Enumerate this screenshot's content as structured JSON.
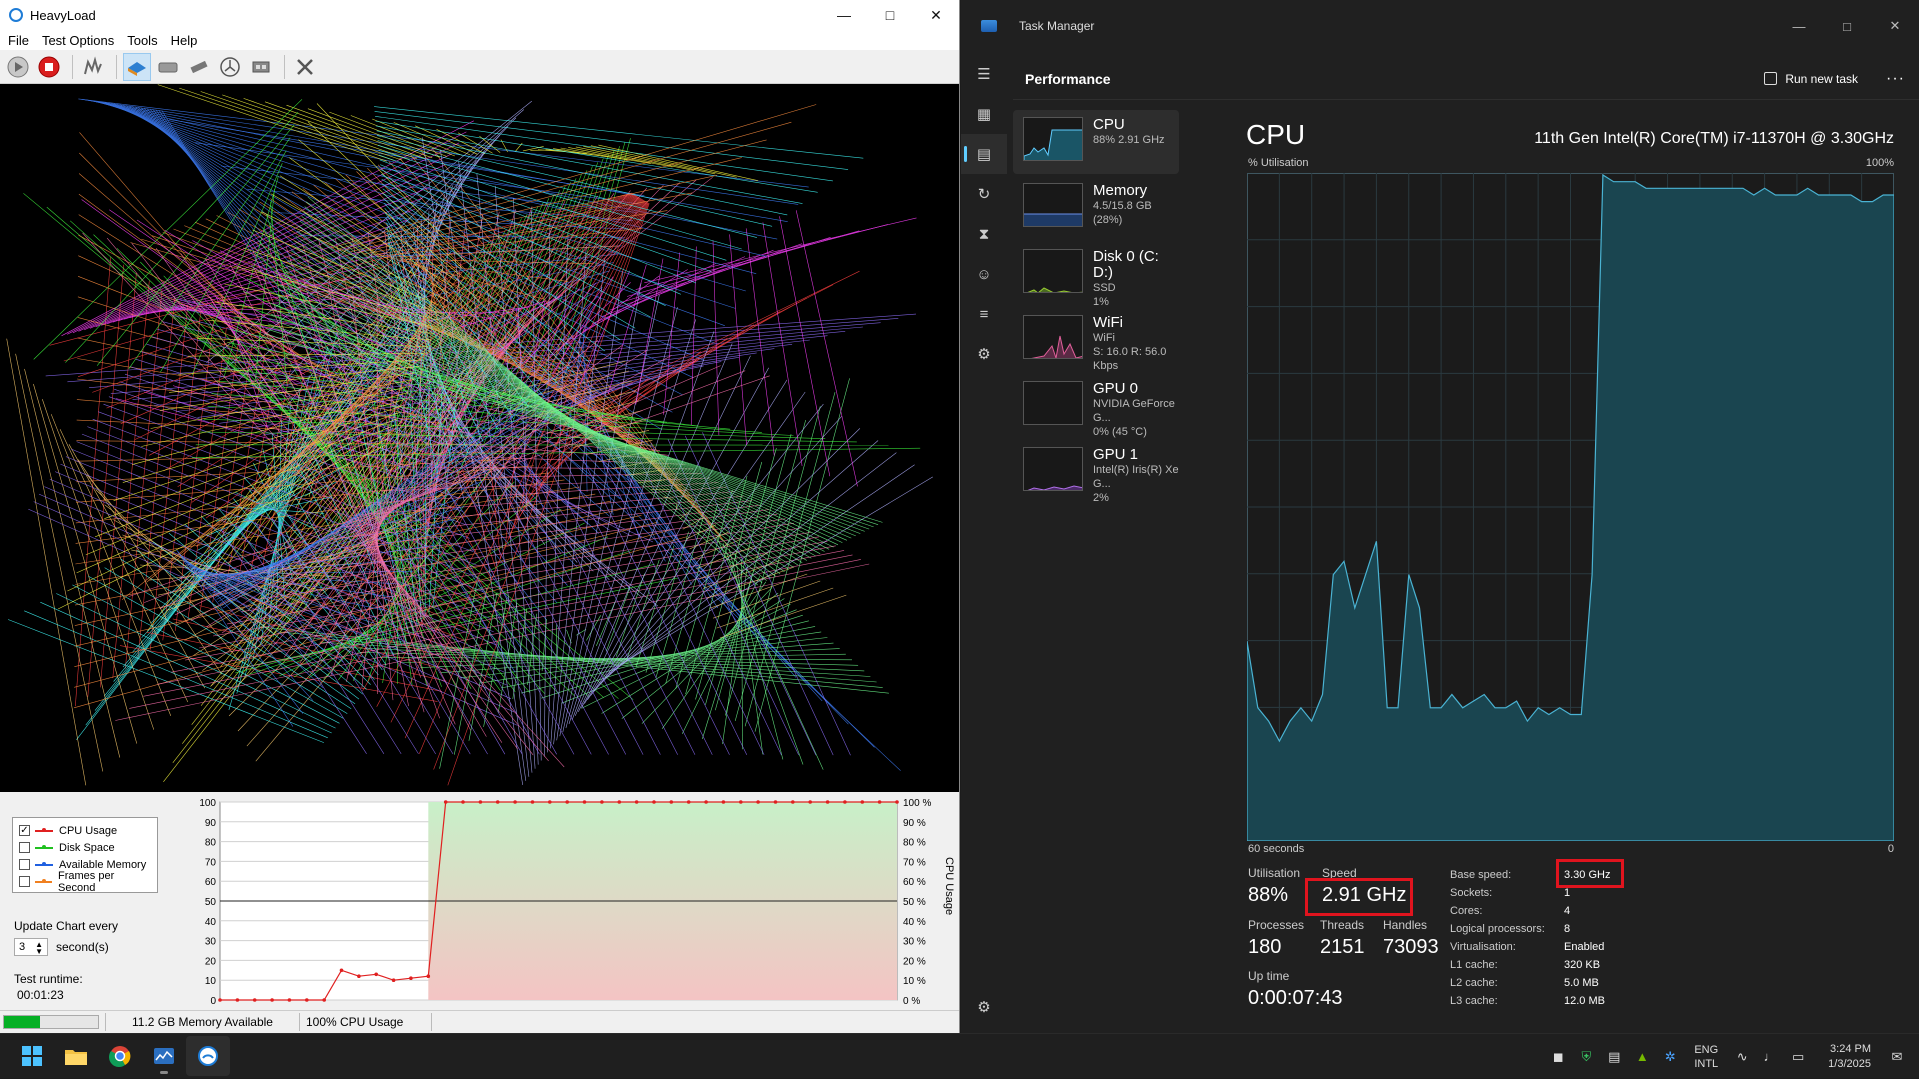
{
  "heavyload": {
    "title": "HeavyLoad",
    "menu": [
      "File",
      "Test Options",
      "Tools",
      "Help"
    ],
    "toolbar_icons": [
      "play-icon",
      "stop-icon",
      "cpu-stress-icon",
      "gpu-stress-icon",
      "disk-icon",
      "memory-icon",
      "clock-icon",
      "chip-icon",
      "tools-icon"
    ],
    "legend": [
      {
        "label": "CPU Usage",
        "checked": true,
        "color": "#e02020"
      },
      {
        "label": "Disk Space",
        "checked": false,
        "color": "#20c020"
      },
      {
        "label": "Available Memory",
        "checked": false,
        "color": "#2060e0"
      },
      {
        "label": "Frames per Second",
        "checked": false,
        "color": "#f08020"
      }
    ],
    "update_label": "Update Chart every",
    "update_value": "3",
    "update_unit": "second(s)",
    "runtime_label": "Test runtime:",
    "runtime_value": "00:01:23",
    "chart_left_ticks": [
      "100",
      "90",
      "80",
      "70",
      "60",
      "50",
      "40",
      "30",
      "20",
      "10",
      "0"
    ],
    "chart_right_ticks": [
      "100 %",
      "90 %",
      "80 %",
      "70 %",
      "60 %",
      "50 %",
      "40 %",
      "30 %",
      "20 %",
      "10 %",
      "0 %"
    ],
    "chart_axis_title": "CPU Usage",
    "status_memory": "11.2 GB Memory Available",
    "status_cpu": "100% CPU Usage",
    "progress_fraction": 0.38
  },
  "chart_data": {
    "type": "line",
    "series": [
      {
        "name": "CPU Usage",
        "values": [
          0,
          0,
          0,
          0,
          0,
          0,
          0,
          15,
          12,
          13,
          10,
          11,
          12,
          100,
          100,
          100,
          100,
          100,
          100,
          100,
          100,
          100,
          100,
          100,
          100,
          100,
          100,
          100,
          100,
          100,
          100,
          100,
          100,
          100,
          100,
          100,
          100,
          100,
          100,
          100
        ]
      }
    ],
    "ylim": [
      0,
      100
    ],
    "ylabel": "CPU Usage"
  },
  "taskmanager": {
    "title": "Task Manager",
    "page": "Performance",
    "run_new_task": "Run new task",
    "more": "···",
    "resources": [
      {
        "name": "CPU",
        "sub1": "88% 2.91 GHz",
        "sub2": ""
      },
      {
        "name": "Memory",
        "sub1": "4.5/15.8 GB (28%)",
        "sub2": ""
      },
      {
        "name": "Disk 0 (C: D:)",
        "sub1": "SSD",
        "sub2": "1%"
      },
      {
        "name": "WiFi",
        "sub1": "WiFi",
        "sub2": "S: 16.0 R: 56.0 Kbps"
      },
      {
        "name": "GPU 0",
        "sub1": "NVIDIA GeForce G...",
        "sub2": "0% (45 °C)"
      },
      {
        "name": "GPU 1",
        "sub1": "Intel(R) Iris(R) Xe G...",
        "sub2": "2%"
      }
    ],
    "cpu_title": "CPU",
    "cpu_model": "11th Gen Intel(R) Core(TM) i7-11370H @ 3.30GHz",
    "util_label": "% Utilisation",
    "util_max": "100%",
    "axis_left": "60 seconds",
    "axis_right": "0",
    "utilisation": {
      "label": "Utilisation",
      "value": "88%"
    },
    "speed": {
      "label": "Speed",
      "value": "2.91 GHz"
    },
    "processes": {
      "label": "Processes",
      "value": "180"
    },
    "threads": {
      "label": "Threads",
      "value": "2151"
    },
    "handles": {
      "label": "Handles",
      "value": "73093"
    },
    "uptime": {
      "label": "Up time",
      "value": "0:00:07:43"
    },
    "specs": [
      {
        "k": "Base speed:",
        "v": "3.30 GHz"
      },
      {
        "k": "Sockets:",
        "v": "1"
      },
      {
        "k": "Cores:",
        "v": "4"
      },
      {
        "k": "Logical processors:",
        "v": "8"
      },
      {
        "k": "Virtualisation:",
        "v": "Enabled"
      },
      {
        "k": "L1 cache:",
        "v": "320 KB"
      },
      {
        "k": "L2 cache:",
        "v": "5.0 MB"
      },
      {
        "k": "L3 cache:",
        "v": "12.0 MB"
      }
    ],
    "cpu_history": [
      30,
      20,
      18,
      15,
      18,
      20,
      18,
      22,
      40,
      42,
      35,
      40,
      45,
      20,
      20,
      40,
      35,
      20,
      20,
      22,
      20,
      21,
      22,
      20,
      20,
      21,
      18,
      20,
      19,
      20,
      19,
      19,
      40,
      100,
      99,
      99,
      99,
      98,
      98,
      98,
      98,
      98,
      98,
      98,
      98,
      98,
      98,
      97,
      98,
      97,
      97,
      97,
      98,
      97,
      97,
      97,
      97,
      96,
      96,
      97,
      97
    ],
    "accent": "#60cdff"
  },
  "taskbar": {
    "apps": [
      "windows-start-icon",
      "file-explorer-icon",
      "chrome-icon",
      "task-manager-icon",
      "heavyload-icon"
    ],
    "lang_1": "ENG",
    "lang_2": "INTL",
    "time": "3:24 PM",
    "date": "1/3/2025"
  }
}
